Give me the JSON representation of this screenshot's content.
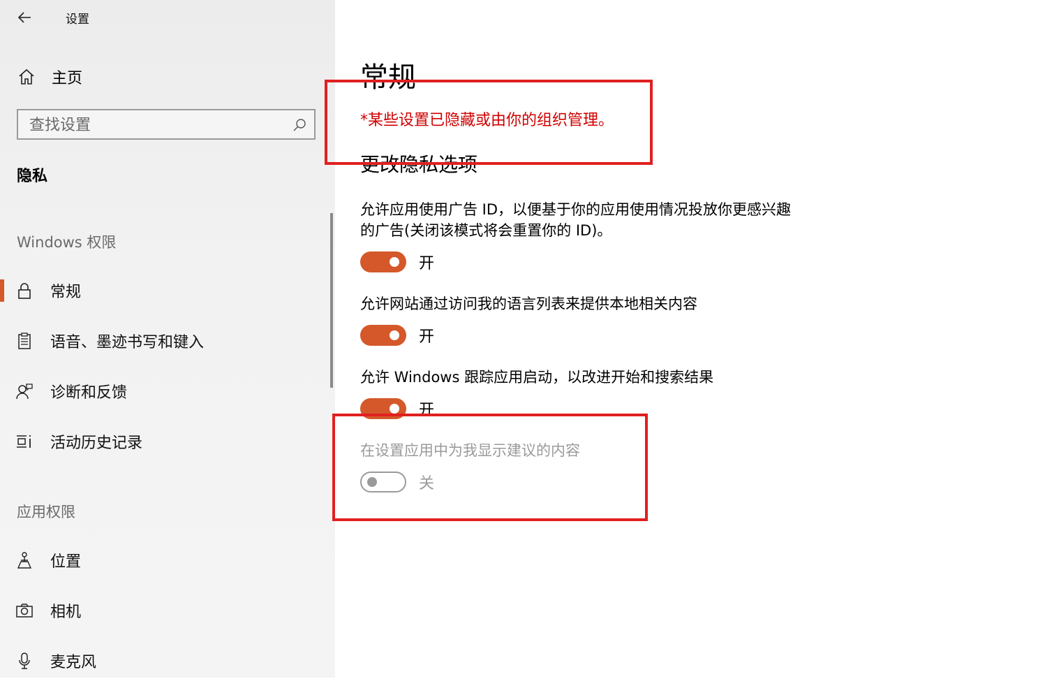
{
  "window": {
    "title": "设置"
  },
  "sidebar": {
    "home_label": "主页",
    "search_placeholder": "查找设置",
    "section_title": "隐私",
    "groups": [
      {
        "header": "Windows 权限",
        "items": [
          {
            "label": "常规",
            "icon": "lock-icon",
            "active": true
          },
          {
            "label": "语音、墨迹书写和键入",
            "icon": "clipboard-icon"
          },
          {
            "label": "诊断和反馈",
            "icon": "feedback-person-icon"
          },
          {
            "label": "活动历史记录",
            "icon": "activity-history-icon"
          }
        ]
      },
      {
        "header": "应用权限",
        "items": [
          {
            "label": "位置",
            "icon": "location-person-icon"
          },
          {
            "label": "相机",
            "icon": "camera-icon"
          },
          {
            "label": "麦克风",
            "icon": "microphone-icon"
          }
        ]
      }
    ]
  },
  "main": {
    "title": "常规",
    "managed_notice": "*某些设置已隐藏或由你的组织管理。",
    "subheading": "更改隐私选项",
    "settings": [
      {
        "description_lines": [
          "允许应用使用广告 ID，以便基于你的应用使用情况投放你更感兴趣",
          "的广告(关闭该模式将会重置你的 ID)。"
        ],
        "state": "开",
        "on": true,
        "disabled": false
      },
      {
        "description_lines": [
          "允许网站通过访问我的语言列表来提供本地相关内容"
        ],
        "state": "开",
        "on": true,
        "disabled": false
      },
      {
        "description_lines": [
          "允许 Windows 跟踪应用启动，以改进开始和搜索结果"
        ],
        "state": "开",
        "on": true,
        "disabled": false
      },
      {
        "description_lines": [
          "在设置应用中为我显示建议的内容"
        ],
        "state": "关",
        "on": false,
        "disabled": true
      }
    ]
  },
  "colors": {
    "accent": "#d4582a",
    "annotation": "#e02020",
    "notice": "#d00000",
    "disabled": "#9a9a9a"
  }
}
